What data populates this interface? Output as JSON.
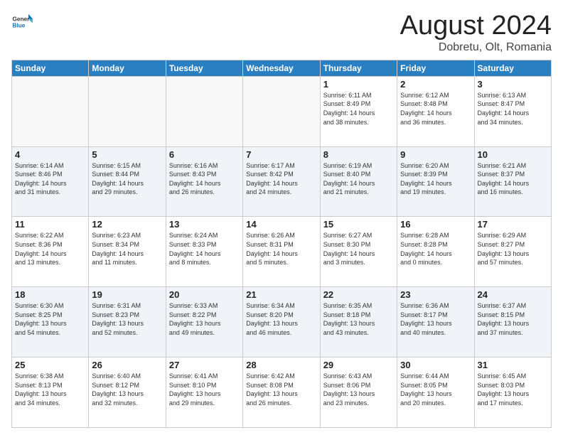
{
  "header": {
    "logo_general": "General",
    "logo_blue": "Blue",
    "month_title": "August 2024",
    "location": "Dobretu, Olt, Romania"
  },
  "weekdays": [
    "Sunday",
    "Monday",
    "Tuesday",
    "Wednesday",
    "Thursday",
    "Friday",
    "Saturday"
  ],
  "weeks": [
    [
      {
        "day": "",
        "info": ""
      },
      {
        "day": "",
        "info": ""
      },
      {
        "day": "",
        "info": ""
      },
      {
        "day": "",
        "info": ""
      },
      {
        "day": "1",
        "info": "Sunrise: 6:11 AM\nSunset: 8:49 PM\nDaylight: 14 hours\nand 38 minutes."
      },
      {
        "day": "2",
        "info": "Sunrise: 6:12 AM\nSunset: 8:48 PM\nDaylight: 14 hours\nand 36 minutes."
      },
      {
        "day": "3",
        "info": "Sunrise: 6:13 AM\nSunset: 8:47 PM\nDaylight: 14 hours\nand 34 minutes."
      }
    ],
    [
      {
        "day": "4",
        "info": "Sunrise: 6:14 AM\nSunset: 8:46 PM\nDaylight: 14 hours\nand 31 minutes."
      },
      {
        "day": "5",
        "info": "Sunrise: 6:15 AM\nSunset: 8:44 PM\nDaylight: 14 hours\nand 29 minutes."
      },
      {
        "day": "6",
        "info": "Sunrise: 6:16 AM\nSunset: 8:43 PM\nDaylight: 14 hours\nand 26 minutes."
      },
      {
        "day": "7",
        "info": "Sunrise: 6:17 AM\nSunset: 8:42 PM\nDaylight: 14 hours\nand 24 minutes."
      },
      {
        "day": "8",
        "info": "Sunrise: 6:19 AM\nSunset: 8:40 PM\nDaylight: 14 hours\nand 21 minutes."
      },
      {
        "day": "9",
        "info": "Sunrise: 6:20 AM\nSunset: 8:39 PM\nDaylight: 14 hours\nand 19 minutes."
      },
      {
        "day": "10",
        "info": "Sunrise: 6:21 AM\nSunset: 8:37 PM\nDaylight: 14 hours\nand 16 minutes."
      }
    ],
    [
      {
        "day": "11",
        "info": "Sunrise: 6:22 AM\nSunset: 8:36 PM\nDaylight: 14 hours\nand 13 minutes."
      },
      {
        "day": "12",
        "info": "Sunrise: 6:23 AM\nSunset: 8:34 PM\nDaylight: 14 hours\nand 11 minutes."
      },
      {
        "day": "13",
        "info": "Sunrise: 6:24 AM\nSunset: 8:33 PM\nDaylight: 14 hours\nand 8 minutes."
      },
      {
        "day": "14",
        "info": "Sunrise: 6:26 AM\nSunset: 8:31 PM\nDaylight: 14 hours\nand 5 minutes."
      },
      {
        "day": "15",
        "info": "Sunrise: 6:27 AM\nSunset: 8:30 PM\nDaylight: 14 hours\nand 3 minutes."
      },
      {
        "day": "16",
        "info": "Sunrise: 6:28 AM\nSunset: 8:28 PM\nDaylight: 14 hours\nand 0 minutes."
      },
      {
        "day": "17",
        "info": "Sunrise: 6:29 AM\nSunset: 8:27 PM\nDaylight: 13 hours\nand 57 minutes."
      }
    ],
    [
      {
        "day": "18",
        "info": "Sunrise: 6:30 AM\nSunset: 8:25 PM\nDaylight: 13 hours\nand 54 minutes."
      },
      {
        "day": "19",
        "info": "Sunrise: 6:31 AM\nSunset: 8:23 PM\nDaylight: 13 hours\nand 52 minutes."
      },
      {
        "day": "20",
        "info": "Sunrise: 6:33 AM\nSunset: 8:22 PM\nDaylight: 13 hours\nand 49 minutes."
      },
      {
        "day": "21",
        "info": "Sunrise: 6:34 AM\nSunset: 8:20 PM\nDaylight: 13 hours\nand 46 minutes."
      },
      {
        "day": "22",
        "info": "Sunrise: 6:35 AM\nSunset: 8:18 PM\nDaylight: 13 hours\nand 43 minutes."
      },
      {
        "day": "23",
        "info": "Sunrise: 6:36 AM\nSunset: 8:17 PM\nDaylight: 13 hours\nand 40 minutes."
      },
      {
        "day": "24",
        "info": "Sunrise: 6:37 AM\nSunset: 8:15 PM\nDaylight: 13 hours\nand 37 minutes."
      }
    ],
    [
      {
        "day": "25",
        "info": "Sunrise: 6:38 AM\nSunset: 8:13 PM\nDaylight: 13 hours\nand 34 minutes."
      },
      {
        "day": "26",
        "info": "Sunrise: 6:40 AM\nSunset: 8:12 PM\nDaylight: 13 hours\nand 32 minutes."
      },
      {
        "day": "27",
        "info": "Sunrise: 6:41 AM\nSunset: 8:10 PM\nDaylight: 13 hours\nand 29 minutes."
      },
      {
        "day": "28",
        "info": "Sunrise: 6:42 AM\nSunset: 8:08 PM\nDaylight: 13 hours\nand 26 minutes."
      },
      {
        "day": "29",
        "info": "Sunrise: 6:43 AM\nSunset: 8:06 PM\nDaylight: 13 hours\nand 23 minutes."
      },
      {
        "day": "30",
        "info": "Sunrise: 6:44 AM\nSunset: 8:05 PM\nDaylight: 13 hours\nand 20 minutes."
      },
      {
        "day": "31",
        "info": "Sunrise: 6:45 AM\nSunset: 8:03 PM\nDaylight: 13 hours\nand 17 minutes."
      }
    ]
  ]
}
